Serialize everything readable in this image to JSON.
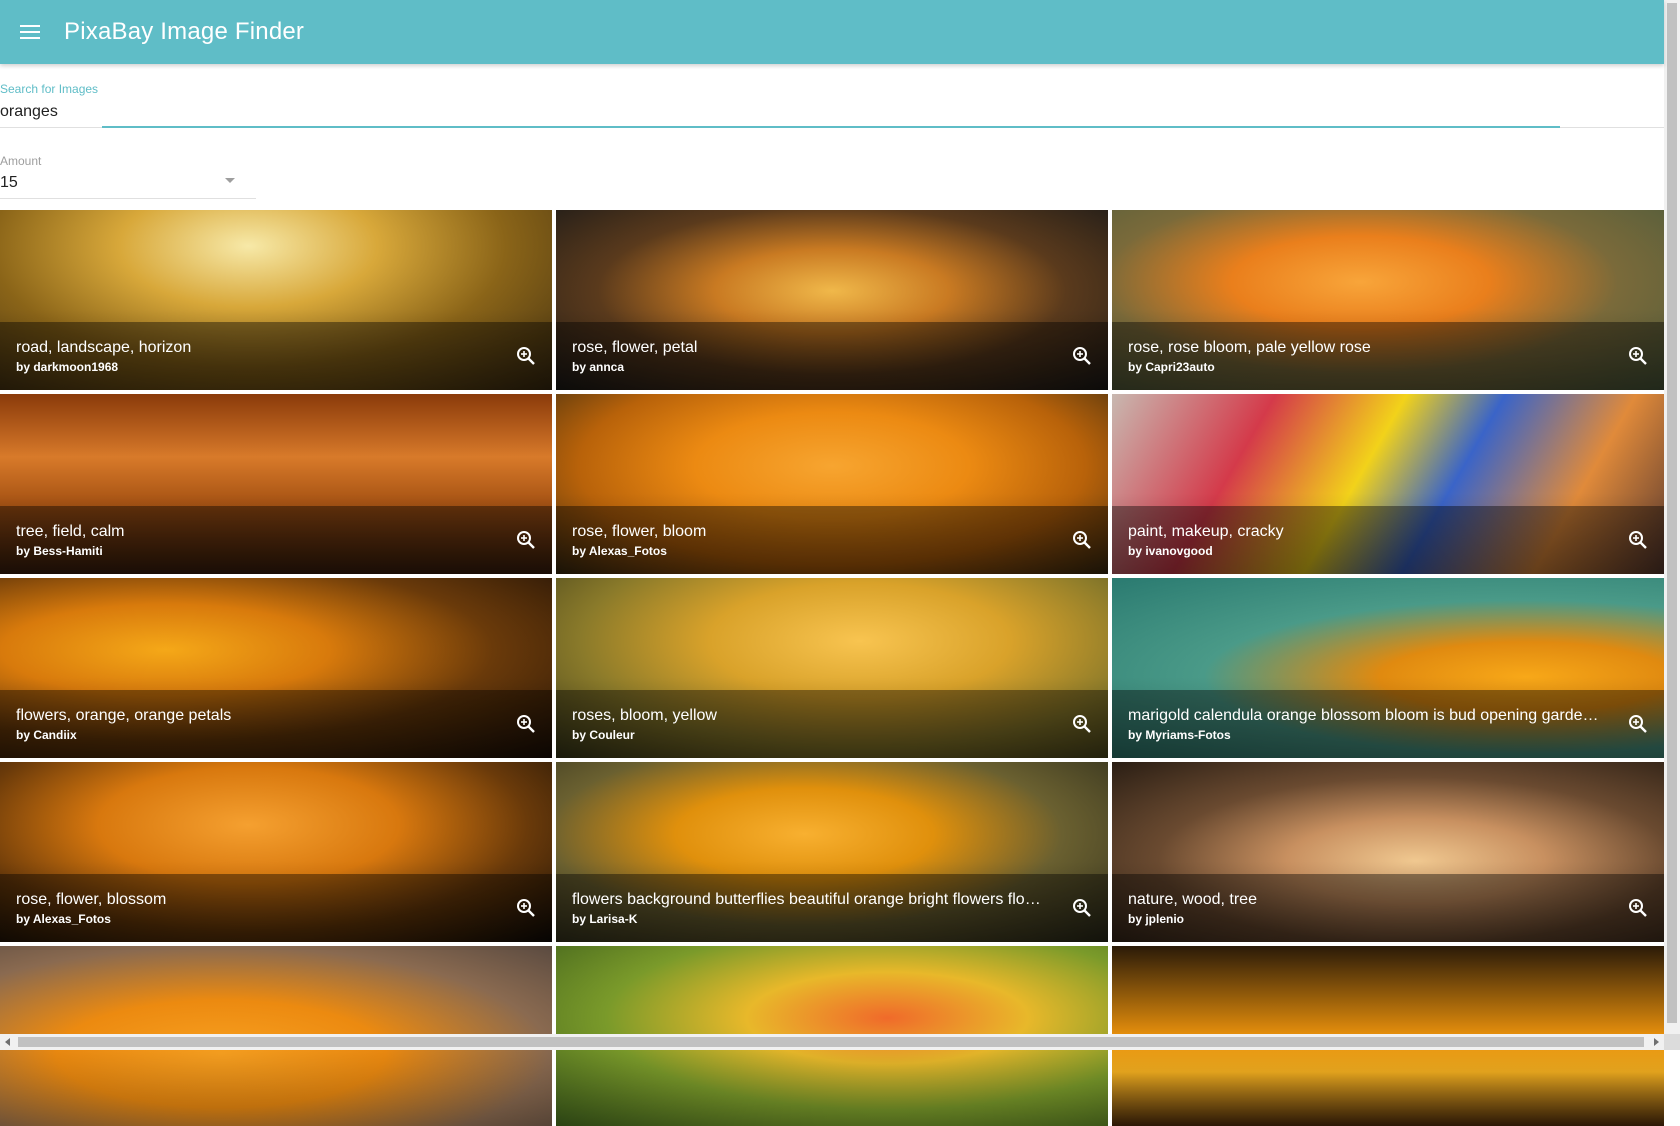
{
  "app": {
    "title": "PixaBay Image Finder",
    "menu_icon": "menu-icon",
    "accent_color": "#5fbdc7"
  },
  "search": {
    "label": "Search for Images",
    "value": "oranges"
  },
  "amount": {
    "label": "Amount",
    "value": "15"
  },
  "images": [
    {
      "title": "road, landscape, horizon",
      "by": "by darkmoon1968"
    },
    {
      "title": "rose, flower, petal",
      "by": "by annca"
    },
    {
      "title": "rose, rose bloom, pale yellow rose",
      "by": "by Capri23auto"
    },
    {
      "title": "tree, field, calm",
      "by": "by Bess-Hamiti"
    },
    {
      "title": "rose, flower, bloom",
      "by": "by Alexas_Fotos"
    },
    {
      "title": "paint, makeup, cracky",
      "by": "by ivanovgood"
    },
    {
      "title": "flowers, orange, orange petals",
      "by": "by Candiix"
    },
    {
      "title": "roses, bloom, yellow",
      "by": "by Couleur"
    },
    {
      "title": "marigold calendula orange blossom bloom is bud opening gardening",
      "by": "by Myriams-Fotos"
    },
    {
      "title": "rose, flower, blossom",
      "by": "by Alexas_Fotos"
    },
    {
      "title": "flowers background butterflies beautiful orange bright flowers flowers",
      "by": "by Larisa-K"
    },
    {
      "title": "nature, wood, tree",
      "by": "by jplenio"
    },
    {
      "title": "",
      "by": ""
    },
    {
      "title": "",
      "by": ""
    },
    {
      "title": "",
      "by": ""
    }
  ]
}
